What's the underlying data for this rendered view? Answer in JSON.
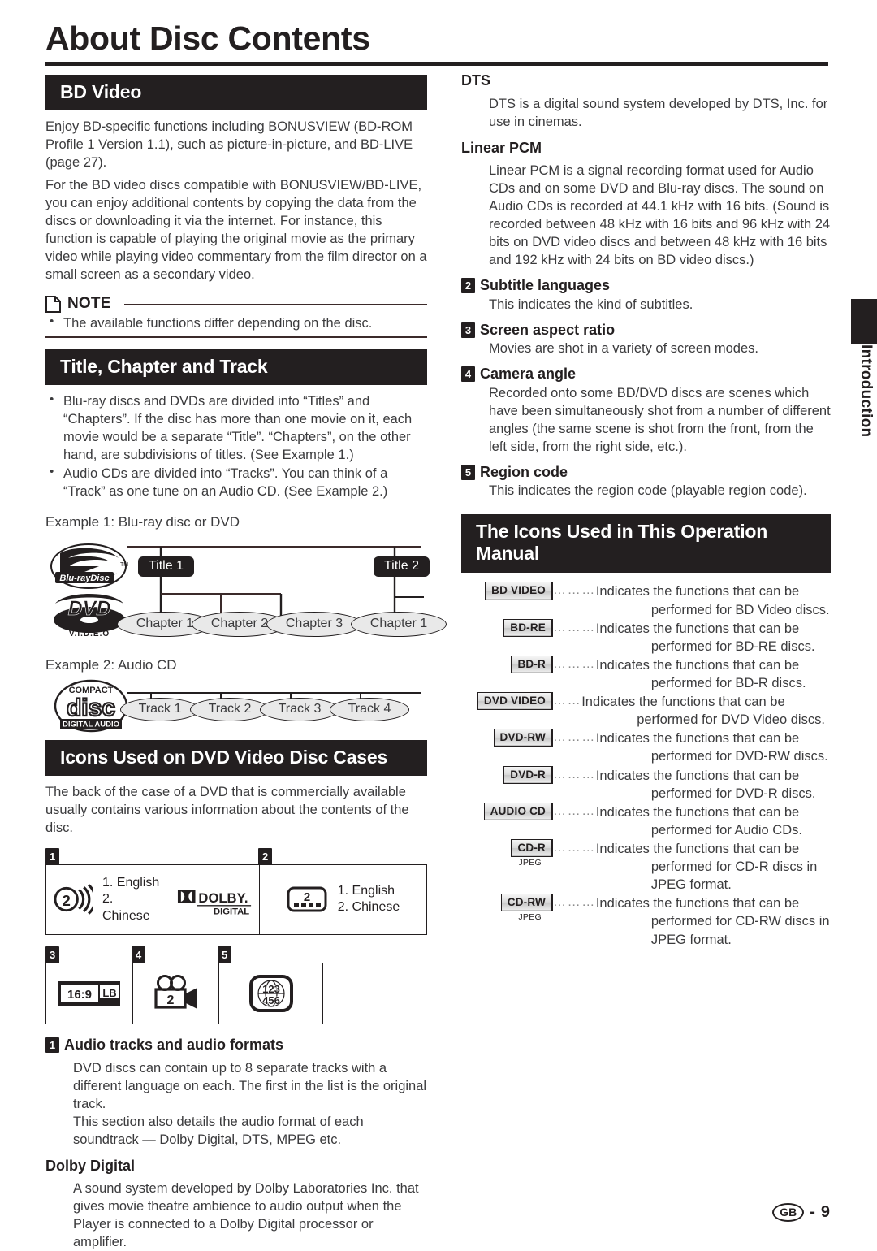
{
  "page": {
    "title": "About Disc Contents",
    "side_tab": "Introduction",
    "footer_region": "GB",
    "footer_separator": "-",
    "footer_page": "9"
  },
  "bd_video": {
    "banner": "BD Video",
    "paragraphs": [
      "Enjoy BD-specific functions including BONUSVIEW (BD-ROM Profile 1 Version 1.1), such as picture-in-picture, and BD-LIVE (page 27).",
      "For the BD video discs compatible with BONUSVIEW/BD-LIVE, you can enjoy additional contents by copying the data from the discs or downloading it via the internet. For instance, this function is capable of playing the original movie as the primary video while playing video commentary from the film director on a small screen as a secondary video."
    ],
    "note": {
      "label": "NOTE",
      "icon": "note-page-icon",
      "items": [
        "The available functions differ depending on the disc."
      ]
    }
  },
  "title_chapter_track": {
    "banner": "Title, Chapter and Track",
    "bullets": [
      "Blu-ray discs and DVDs are divided into “Titles” and “Chapters”. If the disc has more than one movie on it, each movie would be a separate “Title”. “Chapters”, on the other hand, are subdivisions of titles. (See Example 1.)",
      "Audio CDs are divided into “Tracks”. You can think of a “Track” as one tune on an Audio CD. (See Example 2.)"
    ],
    "example1": {
      "label": "Example 1: Blu-ray disc or DVD",
      "logos": [
        "blu-ray-disc-logo",
        "dvd-video-logo"
      ],
      "titles": [
        "Title 1",
        "Title 2"
      ],
      "chapters_title1": [
        "Chapter 1",
        "Chapter 2",
        "Chapter 3"
      ],
      "chapters_title2": [
        "Chapter 1"
      ]
    },
    "example2": {
      "label": "Example 2: Audio CD",
      "logo": "compact-disc-digital-audio-logo",
      "tracks": [
        "Track 1",
        "Track 2",
        "Track 3",
        "Track 4"
      ]
    }
  },
  "dvd_case_icons": {
    "banner": "Icons Used on DVD Video Disc Cases",
    "intro": "The back of the case of a DVD that is commercially available usually contains various information about the contents of the disc.",
    "panels": [
      {
        "mark": "1",
        "icon": "audio-tracks-speaker-icon",
        "icon_value": "2",
        "languages": [
          "1. English",
          "2. Chinese"
        ],
        "format_logo": "dolby-digital-logo",
        "format_logo_top": "DOLBY.",
        "format_logo_bottom": "DIGITAL"
      },
      {
        "mark": "2",
        "icon": "subtitle-languages-icon",
        "icon_value": "2",
        "languages": [
          "1. English",
          "2. Chinese"
        ]
      },
      {
        "mark": "3",
        "icon": "screen-aspect-ratio-icon",
        "icon_left": "16:9",
        "icon_right": "LB"
      },
      {
        "mark": "4",
        "icon": "camera-angle-icon",
        "icon_value": "2"
      },
      {
        "mark": "5",
        "icon": "region-code-globe-icon",
        "icon_digits_top": "1 2 3",
        "icon_digits_bottom": "4 5 6"
      }
    ],
    "descriptions": [
      {
        "num": "1",
        "heading": "Audio tracks and audio formats",
        "body": [
          "DVD discs can contain up to 8 separate tracks with a different language on each. The first in the list is the original track.",
          "This section also details the audio format of each soundtrack — Dolby Digital, DTS, MPEG etc."
        ]
      }
    ],
    "dolby_digital": {
      "heading": "Dolby Digital",
      "body": "A sound system developed by Dolby Laboratories Inc. that gives movie theatre ambience to audio output when the Player is connected to a Dolby Digital processor or amplifier."
    }
  },
  "right_column": {
    "dts": {
      "heading": "DTS",
      "body": "DTS is a digital sound system developed by DTS, Inc. for use in cinemas."
    },
    "linear_pcm": {
      "heading": "Linear PCM",
      "body": "Linear PCM is a signal recording format used for Audio CDs and on some DVD and Blu-ray discs. The sound on Audio CDs is recorded at 44.1 kHz with 16 bits. (Sound is recorded between 48 kHz with 16 bits and 96 kHz with 24 bits on DVD video discs and between 48 kHz with 16 bits and 192 kHz with 24 bits on BD video discs.)"
    },
    "numbered": [
      {
        "num": "2",
        "heading": "Subtitle languages",
        "body": "This indicates the kind of subtitles."
      },
      {
        "num": "3",
        "heading": "Screen aspect ratio",
        "body": "Movies are shot in a variety of screen modes."
      },
      {
        "num": "4",
        "heading": "Camera angle",
        "body": "Recorded onto some BD/DVD discs are scenes which have been simultaneously shot from a number of different angles (the same scene is shot from the front, from the left side, from the right side, etc.)."
      },
      {
        "num": "5",
        "heading": "Region code",
        "body": "This indicates the region code (playable region code)."
      }
    ]
  },
  "manual_icons": {
    "banner": "The Icons Used in This Operation Manual",
    "rows": [
      {
        "badge": "BD VIDEO",
        "sub": "",
        "leader": "………",
        "line1": "Indicates the functions that can be",
        "line2": "performed for BD Video discs."
      },
      {
        "badge": "BD-RE",
        "sub": "",
        "leader": "………",
        "line1": "Indicates the functions that can be",
        "line2": "performed for BD-RE discs."
      },
      {
        "badge": "BD-R",
        "sub": "",
        "leader": "………",
        "line1": "Indicates the functions that can be",
        "line2": "performed for BD-R discs."
      },
      {
        "badge": "DVD VIDEO",
        "sub": "",
        "leader": "……",
        "line1": "Indicates the functions that can be",
        "line2": "performed for DVD Video discs."
      },
      {
        "badge": "DVD-RW",
        "sub": "",
        "leader": "………",
        "line1": "Indicates the functions that can be",
        "line2": "performed for DVD-RW discs."
      },
      {
        "badge": "DVD-R",
        "sub": "",
        "leader": "………",
        "line1": "Indicates the functions that can be",
        "line2": "performed for DVD-R discs."
      },
      {
        "badge": "AUDIO CD",
        "sub": "",
        "leader": "………",
        "line1": "Indicates the functions that can be",
        "line2": "performed for Audio CDs."
      },
      {
        "badge": "CD-R",
        "sub": "JPEG",
        "leader": "………",
        "line1": "Indicates the functions that can be",
        "line2": "performed for CD-R discs in JPEG format."
      },
      {
        "badge": "CD-RW",
        "sub": "JPEG",
        "leader": "………",
        "line1": "Indicates the functions that can be",
        "line2": "performed for CD-RW discs in JPEG format."
      }
    ]
  }
}
